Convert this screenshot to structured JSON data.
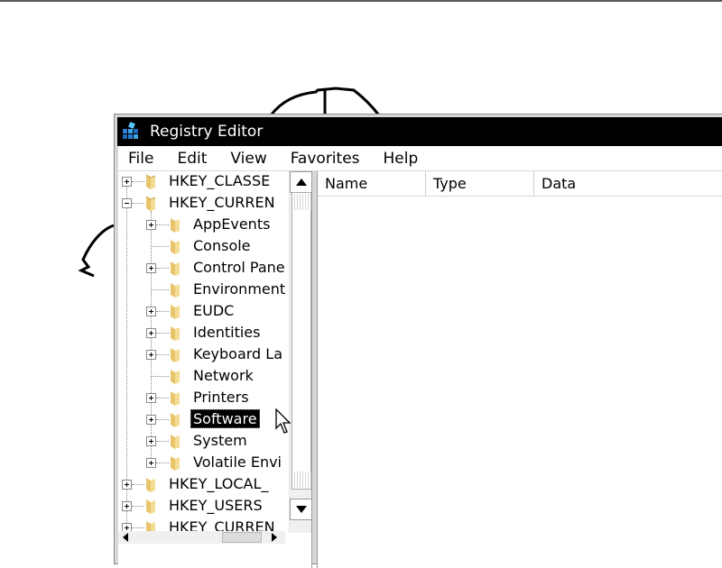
{
  "window": {
    "title": "Registry Editor",
    "icon": "registry-editor-icon"
  },
  "menu": [
    "File",
    "Edit",
    "View",
    "Favorites",
    "Help"
  ],
  "tree": {
    "roots_top": [
      {
        "label": "HKEY_CLASSE",
        "state": "collapsed"
      },
      {
        "label": "HKEY_CURREN",
        "state": "expanded"
      }
    ],
    "children": [
      {
        "label": "AppEvents",
        "expandable": true
      },
      {
        "label": "Console",
        "expandable": false
      },
      {
        "label": "Control Pane",
        "expandable": true
      },
      {
        "label": "Environment",
        "expandable": false
      },
      {
        "label": "EUDC",
        "expandable": true
      },
      {
        "label": "Identities",
        "expandable": true
      },
      {
        "label": "Keyboard La",
        "expandable": true
      },
      {
        "label": "Network",
        "expandable": false
      },
      {
        "label": "Printers",
        "expandable": true
      },
      {
        "label": "Software",
        "expandable": true,
        "selected": true
      },
      {
        "label": "System",
        "expandable": true
      },
      {
        "label": "Volatile Envi",
        "expandable": true
      }
    ],
    "roots_bottom": [
      {
        "label": "HKEY_LOCAL_",
        "state": "collapsed"
      },
      {
        "label": "HKEY_USERS",
        "state": "collapsed"
      },
      {
        "label": "HKEY_CURREN",
        "state": "collapsed"
      }
    ]
  },
  "list": {
    "columns": [
      "Name",
      "Type",
      "Data"
    ]
  },
  "colors": {
    "titlebar": "#000000",
    "selection": "#000000",
    "window_frame": "#d8d8d8"
  }
}
